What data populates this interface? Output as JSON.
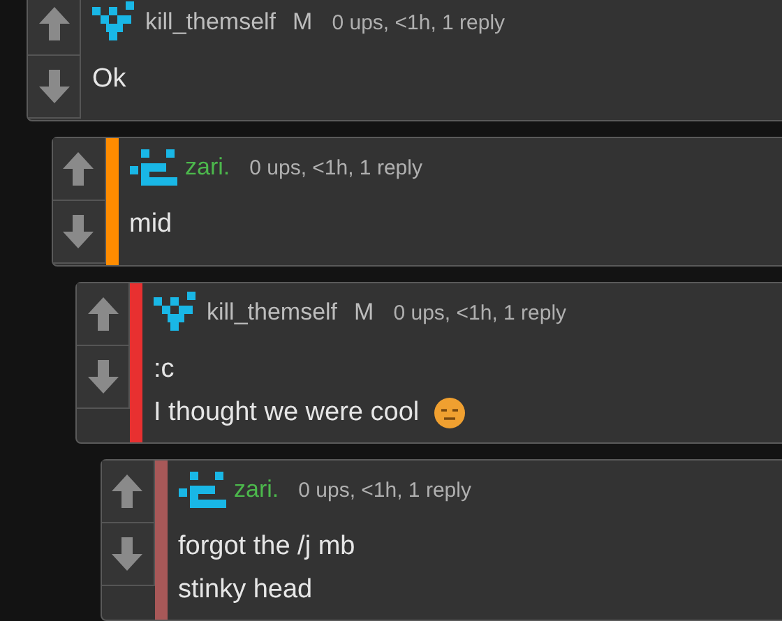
{
  "comments": [
    {
      "kind": "heart",
      "username": "kill_themself",
      "gender": "M",
      "meta": "0 ups, <1h, 1 reply",
      "lines": [
        "Ok"
      ],
      "children": [
        {
          "kind": "smile",
          "username": "zari.",
          "color": "#ff8c00",
          "meta": "0 ups, <1h, 1 reply",
          "lines": [
            "mid"
          ],
          "children": [
            {
              "kind": "heart",
              "username": "kill_themself",
              "gender": "M",
              "color": "#e83030",
              "meta": "0 ups, <1h, 1 reply",
              "lines": [
                ":c",
                "I thought we were cool"
              ],
              "emoji": true,
              "children": [
                {
                  "kind": "smile",
                  "username": "zari.",
                  "color": "#a85858",
                  "meta": "0 ups, <1h, 1 reply",
                  "lines": [
                    "forgot the /j mb",
                    "stinky head"
                  ]
                }
              ]
            }
          ]
        }
      ]
    }
  ]
}
